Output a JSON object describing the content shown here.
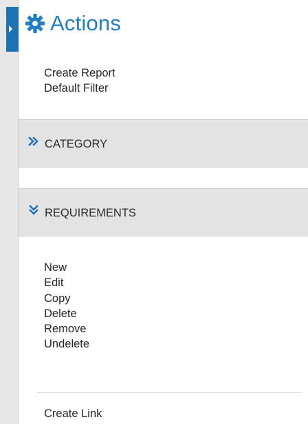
{
  "panel": {
    "title": "Actions",
    "icon": "gear-icon"
  },
  "actions": {
    "items": [
      "Create Report",
      "Default Filter"
    ]
  },
  "sections": {
    "category": {
      "label": "CATEGORY",
      "icon": "double-chevron-right-icon"
    },
    "requirements": {
      "label": "REQUIREMENTS",
      "icon": "double-chevron-down-icon"
    }
  },
  "requirements": {
    "items": [
      "New",
      "Edit",
      "Copy",
      "Delete",
      "Remove",
      "Undelete"
    ],
    "extra_link": "Create Link"
  },
  "colors": {
    "accent": "#1f73b5",
    "title": "#1f7ec7",
    "text": "#262626",
    "section_bg": "#e3e3e3",
    "rail_bg": "#e7e7e7"
  }
}
